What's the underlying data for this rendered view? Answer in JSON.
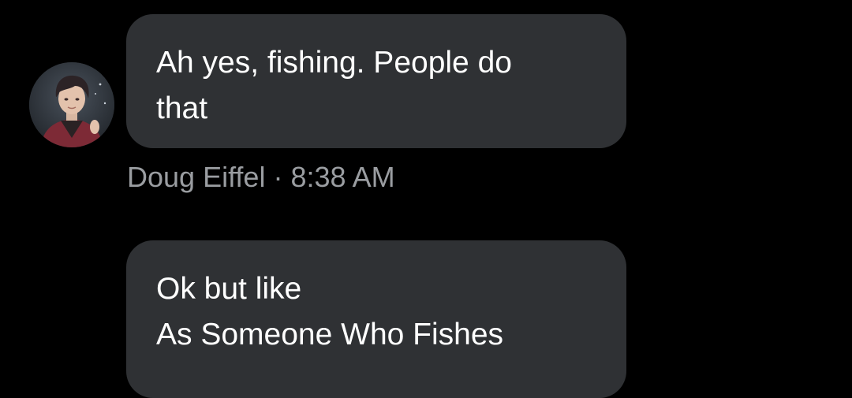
{
  "messages": [
    {
      "sender": "Doug Eiffel",
      "time": "8:38 AM",
      "separator": "·",
      "lines": [
        "Ah yes, fishing. People do",
        "that"
      ]
    },
    {
      "lines": [
        "Ok but like",
        "As Someone Who Fishes"
      ]
    }
  ],
  "avatar": {
    "icon": "user-avatar"
  },
  "colors": {
    "background": "#000000",
    "bubble": "#2f3134",
    "text": "#ffffff",
    "meta": "#9a9da1"
  }
}
